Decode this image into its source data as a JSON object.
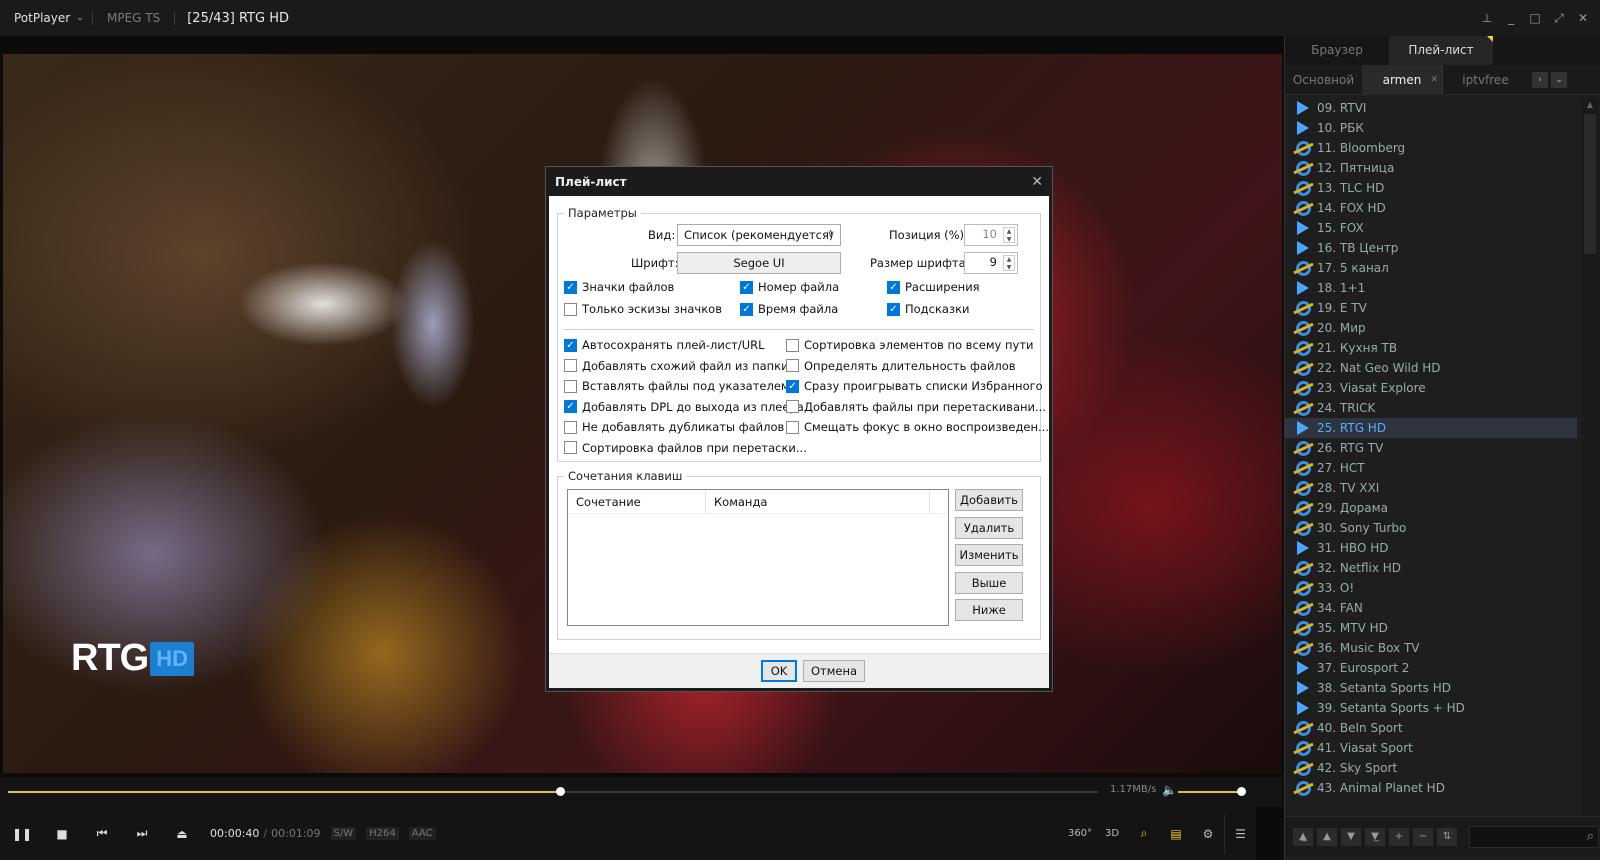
{
  "titlebar": {
    "app_name": "PotPlayer",
    "format": "MPEG TS",
    "title": "[25/43] RTG HD",
    "controls": [
      "pin-icon",
      "minimize-icon",
      "maximize-icon",
      "fullscreen-icon",
      "close-icon"
    ]
  },
  "video": {
    "logo_text": "RTG",
    "logo_badge": "HD"
  },
  "seek": {
    "progress_fraction": 0.506,
    "speed": "1.17MB/s",
    "volume_fraction": 1.0
  },
  "controls": {
    "time_current": "00:00:40",
    "time_separator": "/",
    "time_total": "00:01:09",
    "codec_badges": [
      "S/W",
      "H264",
      "AAC"
    ],
    "right_buttons": [
      "360°",
      "3D"
    ]
  },
  "panel": {
    "tabs": [
      "Браузер",
      "Плей-лист"
    ],
    "active_tab": "Плей-лист",
    "subtabs": [
      "Основной",
      "armen",
      "iptvfree"
    ],
    "active_subtab": "armen",
    "items": [
      {
        "label": "09. RTVI",
        "icon": "play-triangle"
      },
      {
        "label": "10. РБК",
        "icon": "play-triangle"
      },
      {
        "label": "11. Bloomberg",
        "icon": "ie"
      },
      {
        "label": "12. Пятница",
        "icon": "ie"
      },
      {
        "label": "13. TLC HD",
        "icon": "ie"
      },
      {
        "label": "14. FOX HD",
        "icon": "ie"
      },
      {
        "label": "15. FOX",
        "icon": "play-triangle"
      },
      {
        "label": "16. ТВ Центр",
        "icon": "play-triangle"
      },
      {
        "label": "17. 5 канал",
        "icon": "ie"
      },
      {
        "label": "18. 1+1",
        "icon": "play-triangle"
      },
      {
        "label": "19. E TV",
        "icon": "ie"
      },
      {
        "label": "20. Мир",
        "icon": "ie"
      },
      {
        "label": "21. Кухня ТВ",
        "icon": "ie"
      },
      {
        "label": "22. Nat Geo Wild HD",
        "icon": "ie"
      },
      {
        "label": "23. Viasat Explore",
        "icon": "ie"
      },
      {
        "label": "24. TRICK",
        "icon": "ie"
      },
      {
        "label": "25. RTG HD",
        "icon": "play-triangle",
        "active": true
      },
      {
        "label": "26. RTG TV",
        "icon": "ie"
      },
      {
        "label": "27. НСТ",
        "icon": "ie"
      },
      {
        "label": "28. TV XXI",
        "icon": "ie"
      },
      {
        "label": "29. Дорама",
        "icon": "ie"
      },
      {
        "label": "30. Sony Turbo",
        "icon": "ie"
      },
      {
        "label": "31. HBO HD",
        "icon": "play-triangle"
      },
      {
        "label": "32. Netflix HD",
        "icon": "ie"
      },
      {
        "label": "33. O!",
        "icon": "ie"
      },
      {
        "label": "34. FAN",
        "icon": "ie"
      },
      {
        "label": "35. MTV HD",
        "icon": "ie"
      },
      {
        "label": "36. Music Box TV",
        "icon": "ie"
      },
      {
        "label": "37. Eurosport 2",
        "icon": "play-triangle"
      },
      {
        "label": "38. Setanta Sports HD",
        "icon": "play-triangle"
      },
      {
        "label": "39. Setanta Sports + HD",
        "icon": "play-triangle"
      },
      {
        "label": "40. BeIn Sport",
        "icon": "ie"
      },
      {
        "label": "41. Viasat Sport",
        "icon": "ie"
      },
      {
        "label": "42. Sky Sport",
        "icon": "ie"
      },
      {
        "label": "43. Animal Planet HD",
        "icon": "ie"
      }
    ],
    "bottom_tools": [
      "▲̲",
      "▲",
      "▼",
      "▼̲",
      "+",
      "−",
      "⇅"
    ]
  },
  "dialog": {
    "title": "Плей-лист",
    "params_group": "Параметры",
    "view_label": "Вид:",
    "view_value": "Список (рекомендуется)",
    "position_label": "Позиция (%):",
    "position_value": "10",
    "font_label": "Шрифт:",
    "font_value": "Segoe UI",
    "font_size_label": "Размер шрифта:",
    "font_size_value": "9",
    "checks_top": [
      {
        "label": "Значки файлов",
        "checked": true
      },
      {
        "label": "Номер файла",
        "checked": true
      },
      {
        "label": "Расширения",
        "checked": true
      },
      {
        "label": "Только эскизы значков",
        "checked": false
      },
      {
        "label": "Время файла",
        "checked": true
      },
      {
        "label": "Подсказки",
        "checked": true
      }
    ],
    "checks_left": [
      {
        "label": "Автосохранять плей-лист/URL",
        "checked": true
      },
      {
        "label": "Добавлять схожий файл из папки",
        "checked": false
      },
      {
        "label": "Вставлять файлы под указателем",
        "checked": false
      },
      {
        "label": "Добавлять DPL до выхода из плеера",
        "checked": true
      },
      {
        "label": "Не добавлять дубликаты файлов",
        "checked": false
      },
      {
        "label": "Сортировка файлов при перетаски...",
        "checked": false
      }
    ],
    "checks_right": [
      {
        "label": "Сортировка элементов по всему пути",
        "checked": false
      },
      {
        "label": "Определять длительность файлов",
        "checked": false
      },
      {
        "label": "Сразу проигрывать списки Избранного",
        "checked": true
      },
      {
        "label": "Добавлять файлы при перетаскивани...",
        "checked": false
      },
      {
        "label": "Смещать фокус в окно воспроизведен...",
        "checked": false
      }
    ],
    "hotkeys_group": "Сочетания клавиш",
    "col_combo": "Сочетание",
    "col_command": "Команда",
    "btn_add": "Добавить",
    "btn_delete": "Удалить",
    "btn_edit": "Изменить",
    "btn_up": "Выше",
    "btn_down": "Ниже",
    "btn_ok": "OK",
    "btn_cancel": "Отмена"
  }
}
